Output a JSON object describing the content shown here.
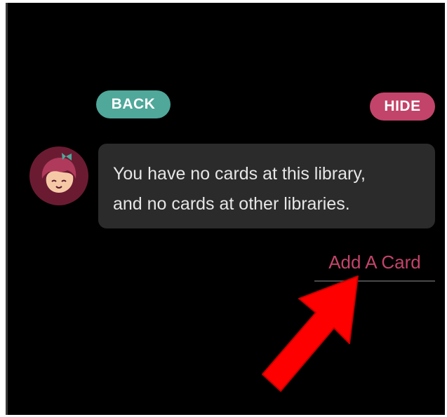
{
  "buttons": {
    "back_label": "BACK",
    "hide_label": "HIDE"
  },
  "message": {
    "line1": "You have no cards at this library,",
    "line2": "and no cards at other libraries."
  },
  "action": {
    "add_card_label": "Add A Card"
  },
  "icons": {
    "avatar": "libby-avatar-icon",
    "arrow": "red-arrow-icon"
  },
  "colors": {
    "back": "#4fa89a",
    "hide": "#c2446a",
    "link": "#c2446a",
    "bubble": "#2b2b2b",
    "arrow": "#ff0000"
  }
}
